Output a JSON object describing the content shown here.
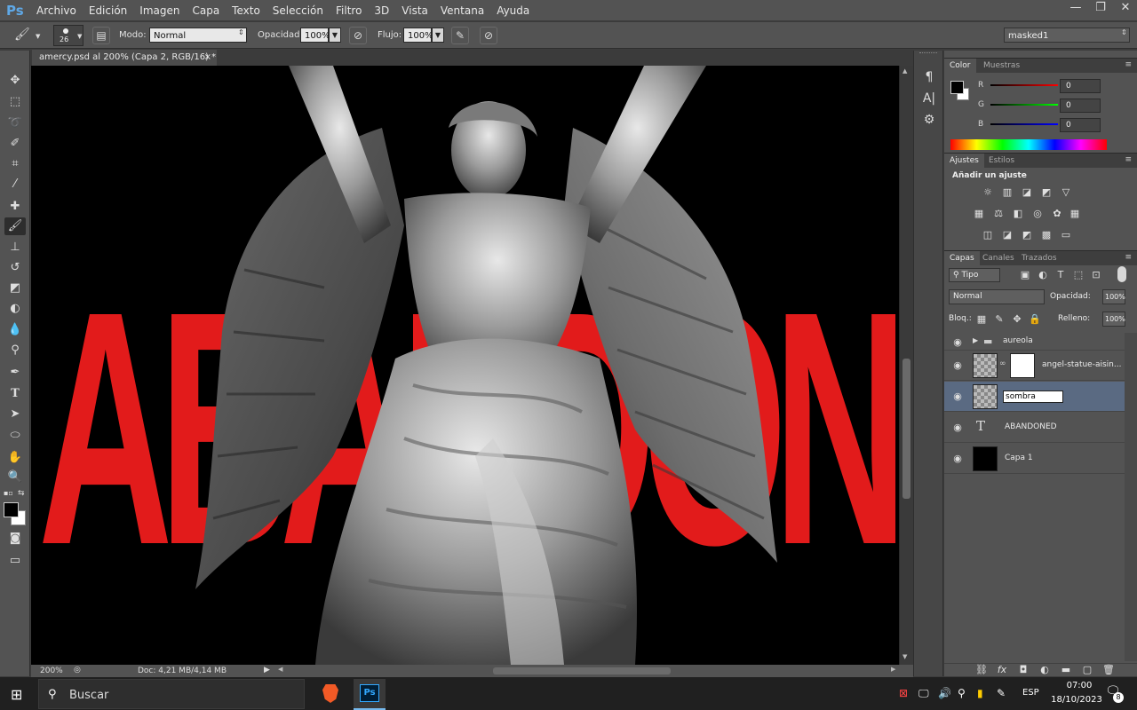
{
  "app": {
    "logo": "Ps"
  },
  "menu": [
    "Archivo",
    "Edición",
    "Imagen",
    "Capa",
    "Texto",
    "Selección",
    "Filtro",
    "3D",
    "Vista",
    "Ventana",
    "Ayuda"
  ],
  "window_controls": [
    "—",
    "❐",
    "✕"
  ],
  "options": {
    "brush_size": "26",
    "mode_label": "Modo:",
    "mode_value": "Normal",
    "opacity_label": "Opacidad:",
    "opacity_value": "100%",
    "flow_label": "Flujo:",
    "flow_value": "100%",
    "workspace": "masked1"
  },
  "document": {
    "tab_title": "amercy.psd al 200% (Capa 2, RGB/16) *",
    "close": "×",
    "zoom": "200%",
    "doc_info": "Doc: 4,21 MB/4,14 MB",
    "canvas_text": "ABANDONED"
  },
  "color_panel": {
    "tabs": [
      "Color",
      "Muestras"
    ],
    "r_label": "R",
    "r_value": "0",
    "g_label": "G",
    "g_value": "0",
    "b_label": "B",
    "b_value": "0"
  },
  "adjust_panel": {
    "tabs": [
      "Ajustes",
      "Estilos"
    ],
    "title": "Añadir un ajuste"
  },
  "layers_panel": {
    "tabs": [
      "Capas",
      "Canales",
      "Trazados"
    ],
    "filter_kind": "Tipo",
    "blend_mode": "Normal",
    "opacity_label": "Opacidad:",
    "opacity_value": "100%",
    "lock_label": "Bloq.:",
    "fill_label": "Relleno:",
    "fill_value": "100%",
    "layers": [
      {
        "name": "aureola",
        "type": "group"
      },
      {
        "name": "angel-statue-aisin...",
        "type": "masked"
      },
      {
        "name": "sombra",
        "type": "editing"
      },
      {
        "name": "ABANDONED",
        "type": "text"
      },
      {
        "name": "Capa 1",
        "type": "fill"
      }
    ]
  },
  "taskbar": {
    "search_placeholder": "Buscar",
    "language": "ESP",
    "time": "07:00",
    "date": "18/10/2023",
    "notification_count": "8"
  },
  "colors": {
    "accent_red": "#e21b1b",
    "ui_dark": "#535353",
    "selected_layer": "#5a6a82"
  }
}
